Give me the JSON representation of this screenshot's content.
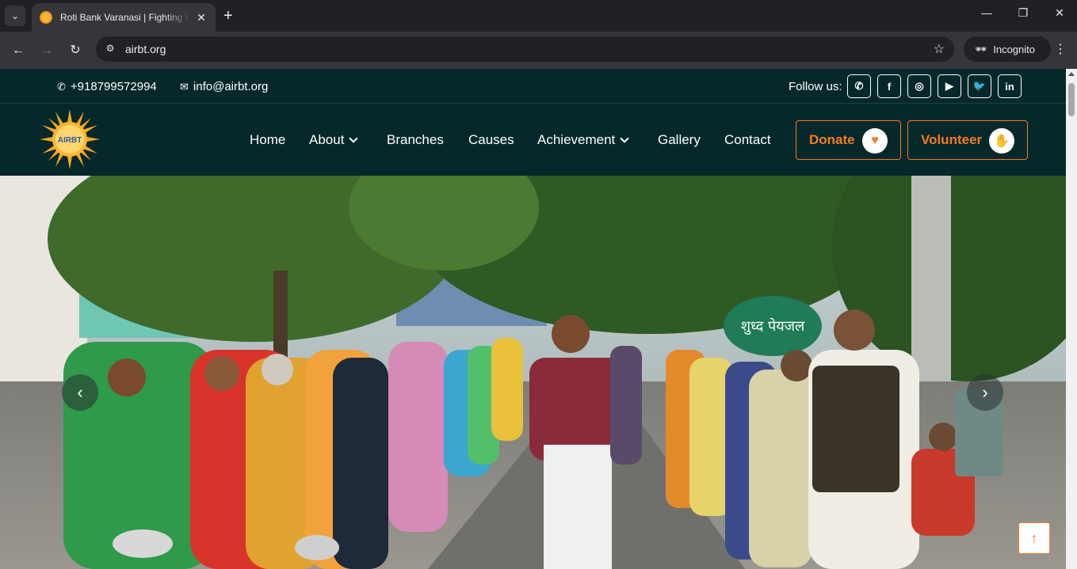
{
  "browser": {
    "tab_title": "Roti Bank Varanasi | Fighting Hunger",
    "tab_close": "✕",
    "new_tab": "+",
    "url": "airbt.org",
    "incognito_label": "Incognito",
    "window_controls": {
      "minimize": "—",
      "maximize": "❐",
      "close": "✕"
    },
    "nav": {
      "back": "←",
      "forward": "→",
      "reload": "↻",
      "star": "☆",
      "menu": "⋮",
      "tab_search": "⌄"
    }
  },
  "topbar": {
    "phone": "+918799572994",
    "email": "info@airbt.org",
    "follow_label": "Follow us:",
    "social": [
      {
        "name": "whatsapp-icon",
        "glyph": "✆"
      },
      {
        "name": "facebook-icon",
        "glyph": "f"
      },
      {
        "name": "instagram-icon",
        "glyph": "◎"
      },
      {
        "name": "youtube-icon",
        "glyph": "▶"
      },
      {
        "name": "twitter-icon",
        "glyph": "🐦"
      },
      {
        "name": "linkedin-icon",
        "glyph": "in"
      }
    ]
  },
  "navbar": {
    "logo_text": "AIRBT",
    "items": {
      "home": "Home",
      "about": "About",
      "branches": "Branches",
      "causes": "Causes",
      "achievement": "Achievement",
      "gallery": "Gallery",
      "contact": "Contact"
    },
    "donate_label": "Donate",
    "volunteer_label": "Volunteer"
  },
  "hero": {
    "prev": "‹",
    "next": "›",
    "sign_text": "शुध्द पेयजल",
    "to_top": "↑"
  },
  "colors": {
    "header_bg": "#06282a",
    "accent": "#f47b20"
  }
}
